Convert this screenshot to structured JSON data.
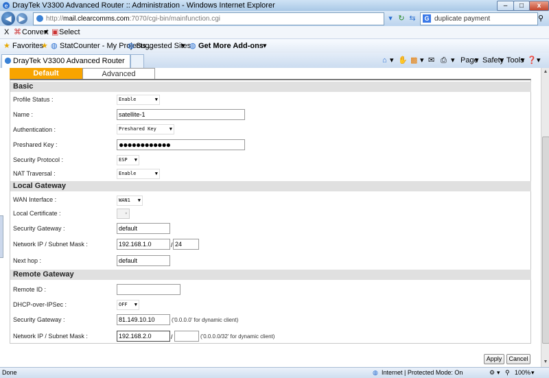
{
  "browser": {
    "window_title": "DrayTek V3300 Advanced Router :: Administration - Windows Internet Explorer",
    "url_prefix": "http://",
    "url_domain": "mail.clearcomms.com",
    "url_path": ":7070/cgi-bin/mainfunction.cgi",
    "search_query": "duplicate payment",
    "command_bar": {
      "close": "X",
      "convert": "Convert",
      "select": "Select"
    },
    "favorites_bar": {
      "favorites": "Favorites",
      "items": [
        "StatCounter - My Projects...",
        "Suggested Sites",
        "Get More Add-ons"
      ]
    },
    "tab_title": "DrayTek V3300 Advanced Router :: Administration",
    "tools": {
      "page": "Page",
      "safety": "Safety",
      "tools": "Tools"
    },
    "status": {
      "left": "Done",
      "zone": "Internet | Protected Mode: On",
      "zoom": "100%"
    }
  },
  "form": {
    "tabs": {
      "default": "Default",
      "advanced": "Advanced"
    },
    "basic": {
      "title": "Basic",
      "profile_status_label": "Profile Status :",
      "profile_status_value": "Enable",
      "name_label": "Name :",
      "name_value": "satellite-1",
      "auth_label": "Authentication :",
      "auth_value": "Preshared Key",
      "psk_label": "Preshared Key :",
      "psk_value": "●●●●●●●●●●●●",
      "protocol_label": "Security Protocol :",
      "protocol_value": "ESP",
      "nat_label": "NAT Traversal :",
      "nat_value": "Enable"
    },
    "local": {
      "title": "Local Gateway",
      "wan_label": "WAN Interface :",
      "wan_value": "WAN1",
      "cert_label": "Local Certificate :",
      "gateway_label": "Security Gateway :",
      "gateway_value": "default",
      "net_label": "Network IP / Subnet Mask :",
      "net_ip": "192.168.1.0",
      "net_mask": "24",
      "nexthop_label": "Next hop :",
      "nexthop_value": "default"
    },
    "remote": {
      "title": "Remote Gateway",
      "id_label": "Remote ID :",
      "id_value": "",
      "dhcp_label": "DHCP-over-IPSec :",
      "dhcp_value": "OFF",
      "gateway_label": "Security Gateway :",
      "gateway_value": "81.149.10.10",
      "gateway_note": "('0.0.0.0' for dynamic client)",
      "net_label": "Network IP / Subnet Mask :",
      "net_ip": "192.168.2.0",
      "net_mask": "",
      "net_note": "('0.0.0.0/32' for dynamic client)"
    },
    "slash": "/",
    "buttons": {
      "apply": "Apply",
      "cancel": "Cancel"
    }
  }
}
